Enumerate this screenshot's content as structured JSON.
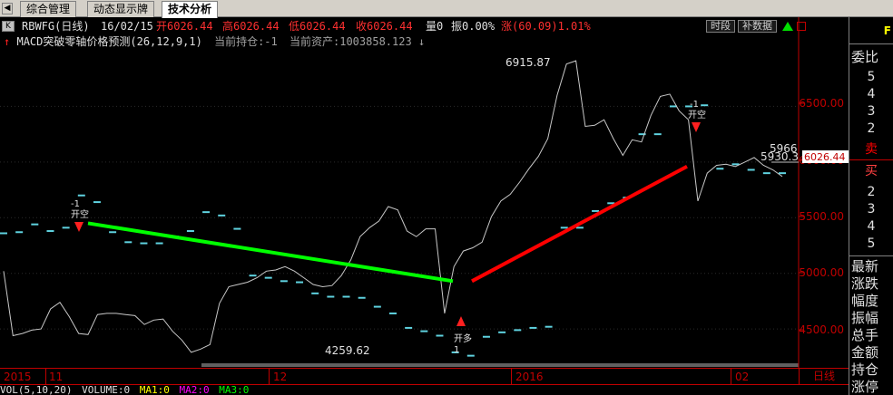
{
  "tabs": {
    "left_button": "◀",
    "items": [
      {
        "label": "综合管理"
      },
      {
        "label": "动态显示牌"
      },
      {
        "label": "技术分析"
      }
    ]
  },
  "header": {
    "k_button": "K",
    "symbol": "RBWFG(日线)",
    "date": "16/02/15",
    "open": "开6026.44",
    "high": "高6026.44",
    "low": "低6026.44",
    "close": "收6026.44",
    "volume": "量0",
    "amplitude": "振0.00%",
    "change": "涨(60.09)1.01%",
    "btn_period": "时段",
    "btn_fill": "补数据"
  },
  "indicator": {
    "name": "MACD突破零轴价格预测(26,12,9,1)",
    "position": "当前持仓:-1",
    "assets": "当前资产:1003858.123"
  },
  "price_axis": {
    "labels": [
      "6500.00",
      "6000.00",
      "5500.00",
      "5000.00",
      "4500.00"
    ],
    "current_price": "6026.44"
  },
  "chart_labels": {
    "high_label": "6915.87",
    "low_label": "4259.62",
    "right_label_1": "5966",
    "right_label_2": "5930.3",
    "signal_short_1": "-1",
    "signal_short_1b": "开空",
    "signal_short_2": "-1",
    "signal_short_2b": "开空",
    "signal_long": "开多",
    "signal_long_num": "1"
  },
  "xaxis": {
    "labels": [
      "2015",
      "11",
      "12",
      "2016",
      "02"
    ],
    "period": "日线"
  },
  "right_panel": {
    "top_letter": "F",
    "title": "委比",
    "sell_levels": [
      "5",
      "4",
      "3",
      "2"
    ],
    "sell_label": "卖",
    "buy_label": "买",
    "buy_levels": [
      "2",
      "3",
      "4",
      "5"
    ],
    "stats": [
      "最新",
      "涨跌",
      "幅度",
      "振幅",
      "总手",
      "金额",
      "持仓",
      "涨停"
    ]
  },
  "volume_row": {
    "vol": "VOL(5,10,20)",
    "volume": "VOLUME:0",
    "ma1": "MA1:0",
    "ma2": "MA2:0",
    "ma3": "MA3:0"
  },
  "colors": {
    "up": "#ff0000",
    "down": "#00e000",
    "axis": "#c00000",
    "dash": "#5fd3e0",
    "line": "#c8c8c8"
  },
  "chart_data": {
    "type": "line",
    "price_line": [
      5020,
      4440,
      4460,
      4490,
      4500,
      4680,
      4740,
      4610,
      4460,
      4450,
      4630,
      4640,
      4640,
      4630,
      4620,
      4540,
      4580,
      4590,
      4480,
      4400,
      4290,
      4320,
      4360,
      4730,
      4880,
      4900,
      4920,
      4960,
      5020,
      5030,
      5060,
      5020,
      4960,
      4900,
      4880,
      4890,
      4980,
      5120,
      5330,
      5410,
      5470,
      5600,
      5570,
      5380,
      5330,
      5400,
      5400,
      4640,
      5060,
      5200,
      5230,
      5280,
      5510,
      5650,
      5710,
      5820,
      5940,
      6050,
      6210,
      6600,
      6880,
      6910,
      6320,
      6330,
      6380,
      6210,
      6060,
      6200,
      6180,
      6420,
      6590,
      6610,
      6460,
      6380,
      5650,
      5900,
      5970,
      5980,
      5960,
      6000,
      6040,
      5970,
      5930,
      5870
    ],
    "dash_levels": [
      5360,
      5370,
      5440,
      5380,
      5410,
      5700,
      5640,
      5370,
      5280,
      5270,
      5270,
      5330,
      5380,
      5550,
      5520,
      5400,
      4980,
      4960,
      4930,
      4920,
      4820,
      4790,
      4790,
      4780,
      4700,
      4640,
      4510,
      4480,
      4440,
      4290,
      4260,
      4430,
      4470,
      4490,
      4510,
      4520,
      5410,
      5410,
      5560,
      5630,
      5680,
      6250,
      6250,
      6500,
      6500,
      6510,
      5940,
      5980,
      5930,
      5900,
      5900
    ],
    "green_line": {
      "from": [
        5450,
        "start"
      ],
      "to": [
        4930,
        "end"
      ]
    },
    "red_line": {
      "from": [
        4930,
        "start"
      ],
      "to": [
        5960,
        "end"
      ]
    },
    "ylim": [
      4200,
      7000
    ],
    "high": 6915.87,
    "low": 4259.62
  }
}
